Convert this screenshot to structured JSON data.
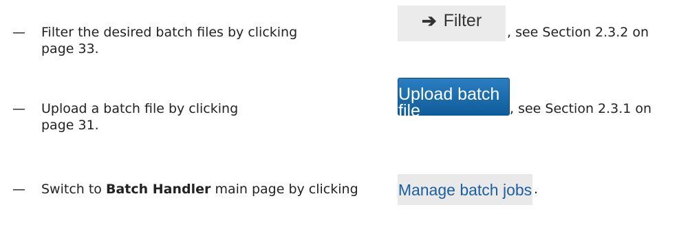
{
  "items": [
    {
      "bullet": "—",
      "text_before": "Filter the desired batch files by clicking",
      "button_arrow": "➔",
      "button_label": "Filter",
      "text_after": ", see Section 2.3.2 on",
      "continuation": "page 33."
    },
    {
      "bullet": "—",
      "text_before": "Upload a batch file by clicking",
      "button_label": "Upload batch file",
      "text_after": ", see Section 2.3.1 on",
      "continuation": "page 31."
    },
    {
      "bullet": "—",
      "text_before": "Switch to ",
      "text_bold": "Batch Handler",
      "text_mid": " main page by clicking",
      "button_label": "Manage batch jobs",
      "text_after": "."
    }
  ]
}
